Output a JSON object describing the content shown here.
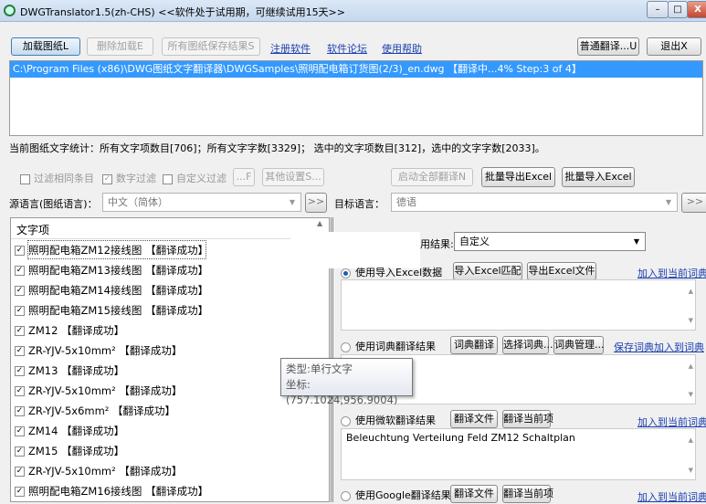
{
  "window": {
    "title": "DWGTranslator1.5(zh-CHS) <<软件处于试用期，可继续试用15天>>",
    "minimize": "–",
    "maximize": "□",
    "close": "X"
  },
  "toolbar": {
    "load": "加载图纸L",
    "remove": "删除加载E",
    "save_all": "所有图纸保存结果S",
    "register": "注册软件",
    "forum": "软件论坛",
    "help": "使用帮助",
    "normal_translate": "普通翻译...U",
    "exit": "退出X"
  },
  "files": [
    "C:\\Program Files (x86)\\DWG图纸文字翻译器\\DWGSamples\\照明配电箱订货图(2/3)_en.dwg  【翻译中...4% Step:3 of 4】"
  ],
  "stats": "当前图纸文字统计：所有文字项数目[706]；所有文字字数[3329]；  选中的文字项数目[312]，选中的文字字数[2033]。",
  "filters": {
    "same": "过滤相同条目",
    "number": "数字过滤",
    "custom": "自定义过滤",
    "f_btn": "...F",
    "other": "其他设置S...",
    "start_all": "启动全部翻译N",
    "batch_export": "批量导出Excel",
    "batch_import": "批量导入Excel"
  },
  "lang": {
    "source_label": "源语言(图纸语言)：",
    "source": "中文（简体）",
    "target_label": "目标语言：",
    "target": "德语",
    "more": ">>"
  },
  "list": {
    "header": "文字项",
    "items": [
      "照明配电箱ZM12接线图  【翻译成功】",
      "照明配电箱ZM13接线图  【翻译成功】",
      "照明配电箱ZM14接线图  【翻译成功】",
      "照明配电箱ZM15接线图  【翻译成功】",
      "ZM12  【翻译成功】",
      "ZR-YJV-5x10mm²  【翻译成功】",
      "ZM13  【翻译成功】",
      "ZR-YJV-5x10mm²  【翻译成功】",
      "ZR-YJV-5x6mm²  【翻译成功】",
      "ZM14  【翻译成功】",
      "ZM15  【翻译成功】",
      "ZR-YJV-5x10mm²  【翻译成功】",
      "照明配电箱ZM16接线图  【翻译成功】"
    ]
  },
  "right": {
    "result_label": "用结果:",
    "result_value": "自定义",
    "excel": {
      "label": "使用导入Excel数据",
      "import": "导入Excel匹配",
      "export": "导出Excel文件",
      "add": "加入到当前词典",
      "text": ""
    },
    "dict": {
      "label": "使用词典翻译结果",
      "translate": "词典翻译",
      "choose": "选择词典...",
      "manage": "词典管理...",
      "save": "保存词典",
      "add": "加入到词典",
      "text": ""
    },
    "ms": {
      "label": "使用微软翻译结果",
      "file": "翻译文件",
      "current": "翻译当前项",
      "add": "加入到当前词典",
      "text": "Beleuchtung Verteilung Feld ZM12 Schaltplan"
    },
    "google": {
      "label": "使用Google翻译结果",
      "file": "翻译文件",
      "current": "翻译当前项",
      "add": "加入到当前词典"
    }
  },
  "tooltip": {
    "type": "类型:单行文字",
    "coord": "坐标:(757.1024,956.9004)"
  }
}
